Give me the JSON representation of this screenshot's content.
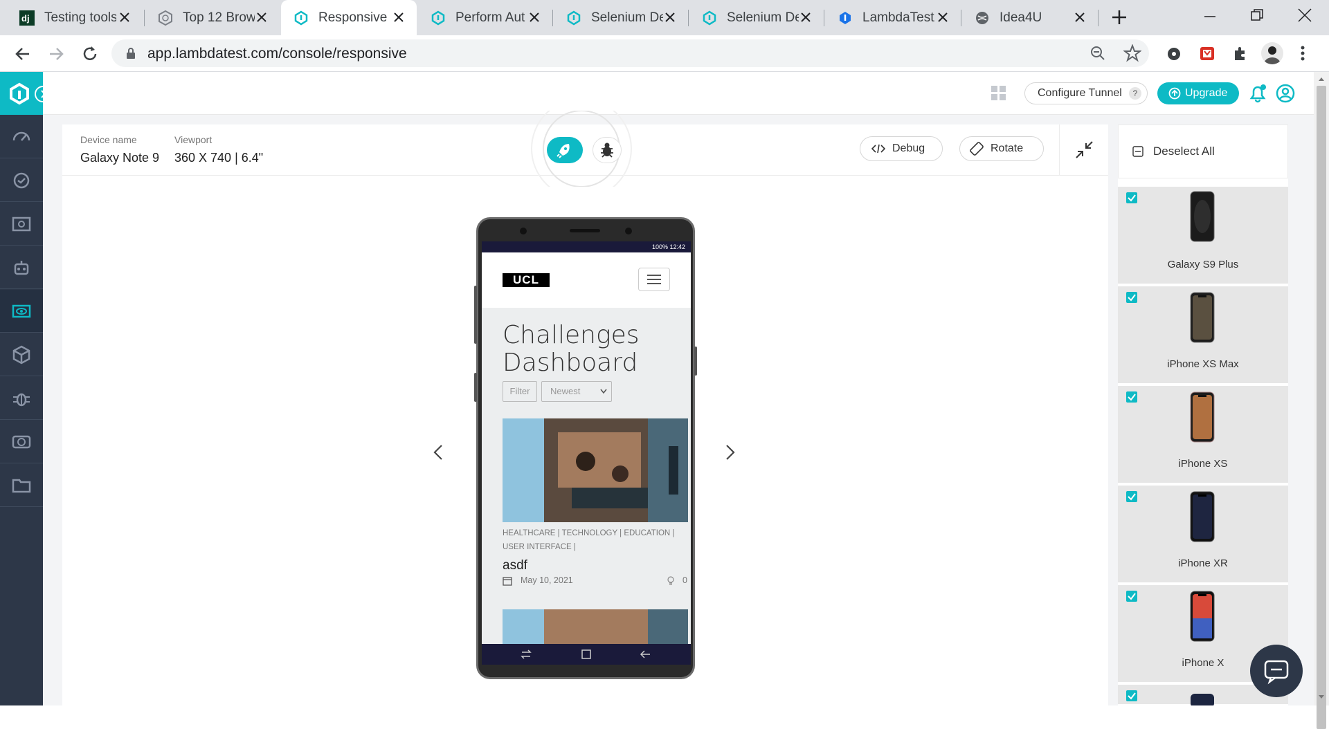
{
  "browser": {
    "tabs": [
      {
        "title": "Testing tools",
        "icon": "dj-favicon-icon"
      },
      {
        "title": "Top 12 Brow",
        "icon": "globe-favicon-icon"
      },
      {
        "title": "Responsive T",
        "icon": "lambdatest-favicon-icon",
        "active": true
      },
      {
        "title": "Perform Aut",
        "icon": "lambdatest-favicon-icon"
      },
      {
        "title": "Selenium De",
        "icon": "lambdatest-favicon-icon"
      },
      {
        "title": "Selenium De",
        "icon": "lambdatest-favicon-icon"
      },
      {
        "title": "LambdaTest/",
        "icon": "lambdatest-favicon-icon"
      },
      {
        "title": "Idea4U",
        "icon": "globe-favicon-icon"
      }
    ],
    "url": "app.lambdatest.com/console/responsive"
  },
  "header": {
    "configure_tunnel": "Configure Tunnel",
    "help": "?",
    "upgrade": "Upgrade"
  },
  "device_bar": {
    "device_label": "Device name",
    "device_value": "Galaxy Note 9",
    "viewport_label": "Viewport",
    "viewport_value": "360 X 740 | 6.4\"",
    "debug": "Debug",
    "rotate": "Rotate"
  },
  "phone": {
    "status_bar": "100% 12:42",
    "logo": "UCL",
    "heading_line1": "Challenges",
    "heading_line2": "Dashboard",
    "filter_button": "Filter",
    "sort_select": "Newest",
    "tags": [
      "HEALTHCARE",
      "TECHNOLOGY",
      "EDUCATION",
      "USER INTERFACE"
    ],
    "card_title": "asdf",
    "card_date": "May 10, 2021",
    "card_count": "0"
  },
  "right_panel": {
    "deselect_all": "Deselect All",
    "devices": [
      "Galaxy S9 Plus",
      "iPhone XS Max",
      "iPhone XS",
      "iPhone XR",
      "iPhone X"
    ]
  },
  "colors": {
    "accent": "#0ebac5",
    "nav_bg": "#2d3748"
  }
}
